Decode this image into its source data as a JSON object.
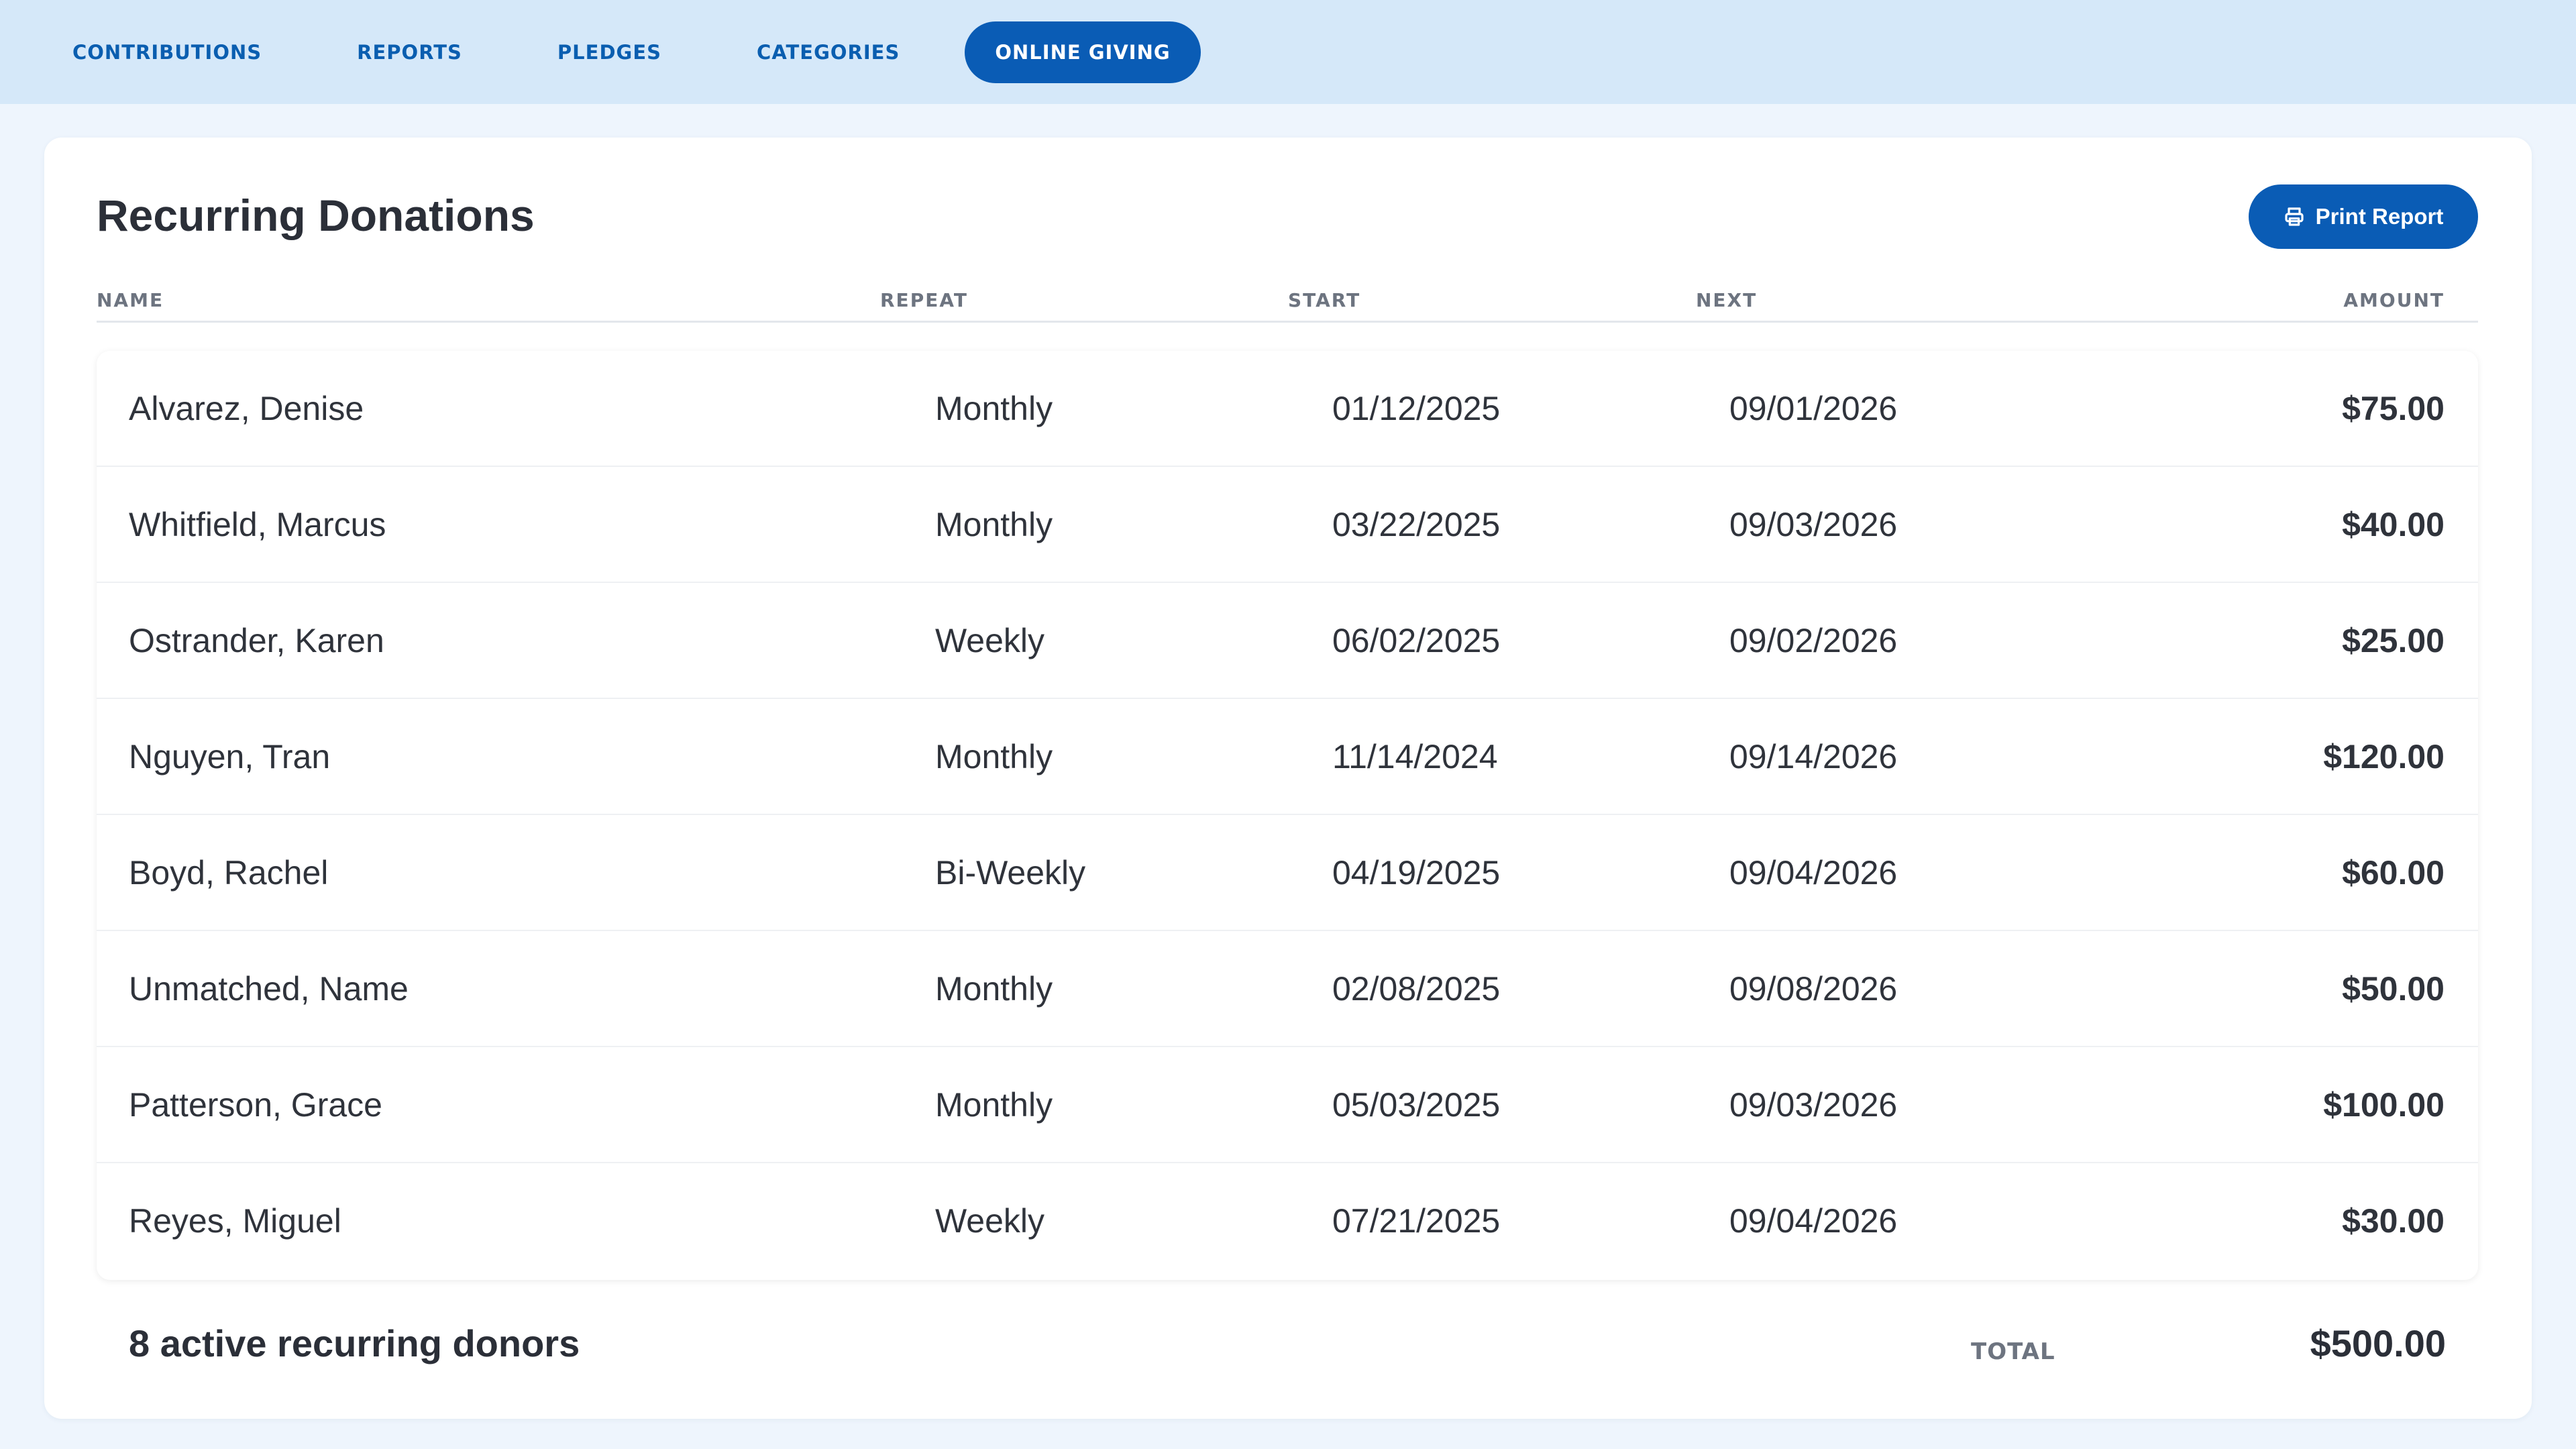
{
  "nav": {
    "tabs": [
      {
        "label": "CONTRIBUTIONS"
      },
      {
        "label": "REPORTS"
      },
      {
        "label": "PLEDGES"
      },
      {
        "label": "CATEGORIES"
      },
      {
        "label": "ONLINE GIVING",
        "active": true
      }
    ]
  },
  "page": {
    "title": "Recurring Donations",
    "print_button": {
      "label": "Print Report",
      "icon": "printer-icon"
    }
  },
  "table": {
    "columns": [
      "NAME",
      "REPEAT",
      "START",
      "NEXT",
      "AMOUNT"
    ],
    "rows": [
      {
        "name": "Alvarez, Denise",
        "repeat": "Monthly",
        "start": "01/12/2025",
        "next": "09/01/2026",
        "amount": "$75.00"
      },
      {
        "name": "Whitfield, Marcus",
        "repeat": "Monthly",
        "start": "03/22/2025",
        "next": "09/03/2026",
        "amount": "$40.00"
      },
      {
        "name": "Ostrander, Karen",
        "repeat": "Weekly",
        "start": "06/02/2025",
        "next": "09/02/2026",
        "amount": "$25.00"
      },
      {
        "name": "Nguyen, Tran",
        "repeat": "Monthly",
        "start": "11/14/2024",
        "next": "09/14/2026",
        "amount": "$120.00"
      },
      {
        "name": "Boyd, Rachel",
        "repeat": "Bi-Weekly",
        "start": "04/19/2025",
        "next": "09/04/2026",
        "amount": "$60.00"
      },
      {
        "name": "Unmatched, Name",
        "repeat": "Monthly",
        "start": "02/08/2025",
        "next": "09/08/2026",
        "amount": "$50.00"
      },
      {
        "name": "Patterson, Grace",
        "repeat": "Monthly",
        "start": "05/03/2025",
        "next": "09/03/2026",
        "amount": "$100.00"
      },
      {
        "name": "Reyes, Miguel",
        "repeat": "Weekly",
        "start": "07/21/2025",
        "next": "09/04/2026",
        "amount": "$30.00"
      }
    ]
  },
  "footer": {
    "count_text": "8 active recurring donors",
    "total_label": "TOTAL",
    "total_value": "$500.00"
  },
  "colors": {
    "accent": "#0a5cb5",
    "nav_bg": "#d5e8f9",
    "page_bg": "#eef5fd"
  }
}
